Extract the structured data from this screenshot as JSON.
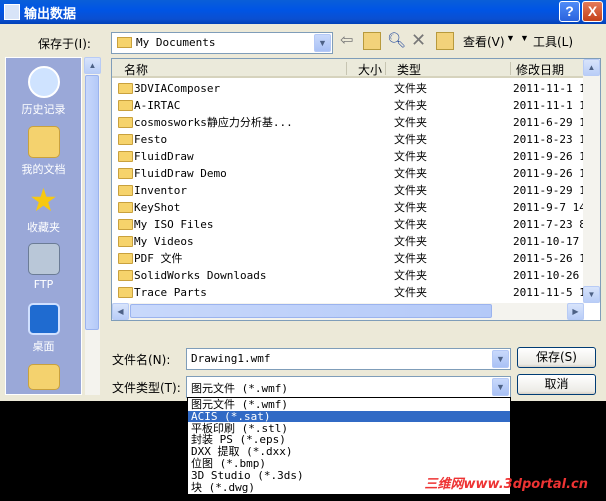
{
  "window": {
    "title": "输出数据",
    "help_label": "?",
    "close_label": "X"
  },
  "toolbar": {
    "save_in_label": "保存于(I):",
    "location": "My Documents",
    "view_label": "查看(V)",
    "tools_label": "工具(L)"
  },
  "places": [
    {
      "label": "历史记录",
      "icon": "history-icon"
    },
    {
      "label": "我的文档",
      "icon": "documents-icon"
    },
    {
      "label": "收藏夹",
      "icon": "favorites-icon"
    },
    {
      "label": "FTP",
      "icon": "ftp-icon"
    },
    {
      "label": "桌面",
      "icon": "desktop-icon"
    }
  ],
  "columns": {
    "name": "名称",
    "size": "大小",
    "type": "类型",
    "modified": "修改日期"
  },
  "files": [
    {
      "name": "3DVIAComposer",
      "type": "文件夹",
      "date": "2011-11-1 1"
    },
    {
      "name": "A-IRTAC",
      "type": "文件夹",
      "date": "2011-11-1 1"
    },
    {
      "name": "cosmosworks静应力分析基...",
      "type": "文件夹",
      "date": "2011-6-29 1"
    },
    {
      "name": "Festo",
      "type": "文件夹",
      "date": "2011-8-23 1"
    },
    {
      "name": "FluidDraw",
      "type": "文件夹",
      "date": "2011-9-26 1"
    },
    {
      "name": "FluidDraw Demo",
      "type": "文件夹",
      "date": "2011-9-26 1"
    },
    {
      "name": "Inventor",
      "type": "文件夹",
      "date": "2011-9-29 1"
    },
    {
      "name": "KeyShot",
      "type": "文件夹",
      "date": "2011-9-7 14"
    },
    {
      "name": "My ISO Files",
      "type": "文件夹",
      "date": "2011-7-23 8"
    },
    {
      "name": "My Videos",
      "type": "文件夹",
      "date": "2011-10-17"
    },
    {
      "name": "PDF 文件",
      "type": "文件夹",
      "date": "2011-5-26 1"
    },
    {
      "name": "SolidWorks Downloads",
      "type": "文件夹",
      "date": "2011-10-26"
    },
    {
      "name": "Trace Parts",
      "type": "文件夹",
      "date": "2011-11-5 1"
    }
  ],
  "filename": {
    "label": "文件名(N):",
    "value": "Drawing1.wmf"
  },
  "filetype": {
    "label": "文件类型(T):",
    "value": "图元文件 (*.wmf)"
  },
  "buttons": {
    "save": "保存(S)",
    "cancel": "取消"
  },
  "filetype_options": [
    "图元文件 (*.wmf)",
    "ACIS (*.sat)",
    "平板印刷 (*.stl)",
    "封装 PS (*.eps)",
    "DXX 提取 (*.dxx)",
    "位图 (*.bmp)",
    "3D Studio (*.3ds)",
    "块 (*.dwg)"
  ],
  "selected_option_index": 1,
  "watermark": "三维网www.3dportal.cn"
}
